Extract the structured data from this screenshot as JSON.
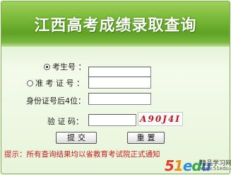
{
  "header": {
    "title": "江西高考成绩录取查询"
  },
  "form": {
    "exam_no": {
      "label": "考生号 ：",
      "checked": true,
      "value": ""
    },
    "admission_no": {
      "label": "准 考 证 号 ：",
      "checked": false,
      "value": ""
    },
    "id_last4": {
      "label": "身份证号后4位：",
      "value": ""
    },
    "captcha": {
      "label": "验 证 码：",
      "value": "",
      "image_text": "A90J4I"
    }
  },
  "buttons": {
    "submit": "提交",
    "reset": "重置"
  },
  "tip": "提示：所有查询结果均以省教育考试院正式通知",
  "watermark": {
    "logo_text": "51edu",
    "tagline": "精品学习网",
    "url": "www.51edu.com"
  }
}
